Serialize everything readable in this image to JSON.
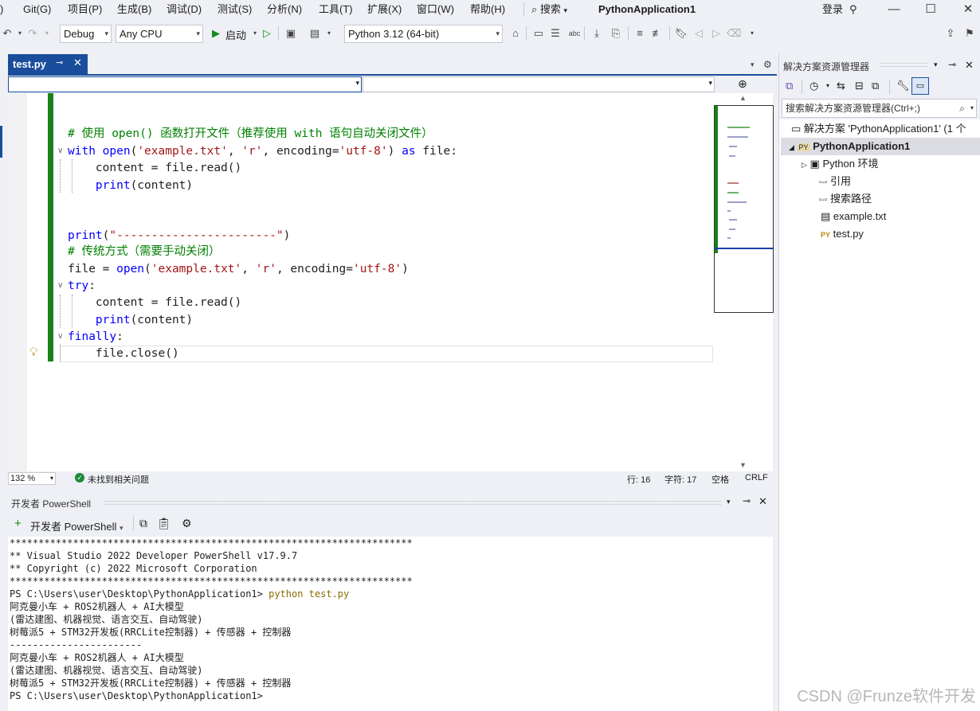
{
  "menubar": {
    "items": [
      "Git(G)",
      "项目(P)",
      "生成(B)",
      "调试(D)",
      "测试(S)",
      "分析(N)",
      "工具(T)",
      "扩展(X)",
      "窗口(W)",
      "帮助(H)"
    ],
    "search_label": "搜索",
    "app_title": "PythonApplication1",
    "login_label": "登录"
  },
  "toolbar": {
    "config": "Debug",
    "platform": "Any CPU",
    "start_label": "启动",
    "python_env": "Python 3.12 (64-bit)"
  },
  "editor": {
    "tab_name": "test.py",
    "code_lines": [
      {
        "t": "# 使用 open() 函数打开文件（推荐使用 with 语句自动关闭文件）"
      },
      {
        "t": "with open('example.txt', 'r', encoding='utf-8') as file:"
      },
      {
        "t": "    content = file.read()"
      },
      {
        "t": "    print(content)"
      },
      {
        "t": ""
      },
      {
        "t": "print(\"-----------------------\")"
      },
      {
        "t": "# 传统方式（需要手动关闭）"
      },
      {
        "t": "file = open('example.txt', 'r', encoding='utf-8')"
      },
      {
        "t": "try:"
      },
      {
        "t": "    content = file.read()"
      },
      {
        "t": "    print(content)"
      },
      {
        "t": "finally:"
      },
      {
        "t": "    file.close()"
      }
    ],
    "zoom": "132 %",
    "issues": "未找到相关问题",
    "line_label": "行: 16",
    "char_label": "字符: 17",
    "space_label": "空格",
    "eol_label": "CRLF"
  },
  "terminal": {
    "title": "开发者 PowerShell",
    "new_label": "开发者 PowerShell",
    "lines": [
      "**********************************************************************",
      "** Visual Studio 2022 Developer PowerShell v17.9.7",
      "** Copyright (c) 2022 Microsoft Corporation",
      "**********************************************************************",
      "PS C:\\Users\\user\\Desktop\\PythonApplication1> ",
      "阿克曼小车 + ROS2机器人 + AI大模型",
      "(雷达建图、机器视觉、语言交互、自动驾驶)",
      "树莓派5 + STM32开发板(RRCLite控制器) + 传感器 + 控制器",
      "-----------------------",
      "阿克曼小车 + ROS2机器人 + AI大模型",
      "(雷达建图、机器视觉、语言交互、自动驾驶)",
      "树莓派5 + STM32开发板(RRCLite控制器) + 传感器 + 控制器",
      "PS C:\\Users\\user\\Desktop\\PythonApplication1>"
    ],
    "command": "python test.py"
  },
  "solution_explorer": {
    "title": "解决方案资源管理器",
    "search_placeholder": "搜索解决方案资源管理器(Ctrl+;)",
    "items": [
      {
        "label": "解决方案 'PythonApplication1' (1 个"
      },
      {
        "label": "PythonApplication1"
      },
      {
        "label": "Python 环境"
      },
      {
        "label": "引用"
      },
      {
        "label": "搜索路径"
      },
      {
        "label": "example.txt"
      },
      {
        "label": "test.py"
      }
    ]
  },
  "watermark": "CSDN @Frunze软件开发"
}
